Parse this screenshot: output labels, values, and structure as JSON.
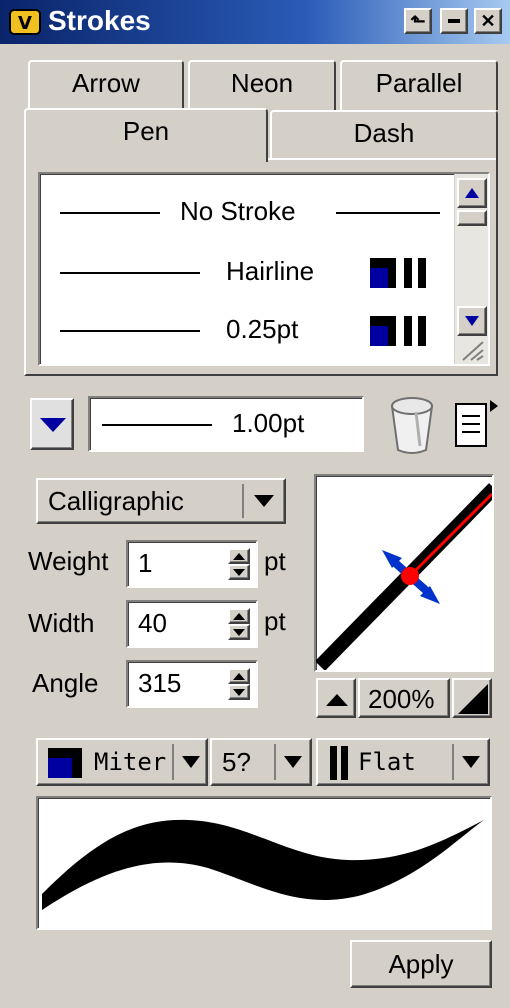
{
  "window": {
    "title": "Strokes"
  },
  "tabs": {
    "back_row": [
      "Arrow",
      "Neon",
      "Parallel"
    ],
    "front_row": [
      "Pen",
      "Dash"
    ],
    "active": "Pen"
  },
  "stroke_list": {
    "items": [
      {
        "label": "No Stroke"
      },
      {
        "label": "Hairline"
      },
      {
        "label": "0.25pt"
      }
    ]
  },
  "current_stroke": {
    "label": "1.00pt"
  },
  "pen_type": {
    "selected": "Calligraphic"
  },
  "fields": {
    "weight": {
      "label": "Weight",
      "value": "1",
      "unit": "pt"
    },
    "width": {
      "label": "Width",
      "value": "40",
      "unit": "pt"
    },
    "angle": {
      "label": "Angle",
      "value": "315"
    }
  },
  "preview_zoom": {
    "value": "200%"
  },
  "join": {
    "selected": "Miter"
  },
  "miter_limit": {
    "selected": "5?"
  },
  "cap": {
    "selected": "Flat"
  },
  "apply_button": {
    "label": "Apply"
  },
  "colors": {
    "titlebar": "#0a246a",
    "face": "#d4d0c8",
    "accent_blue": "#0000a0",
    "handle_red": "#ff0000"
  }
}
